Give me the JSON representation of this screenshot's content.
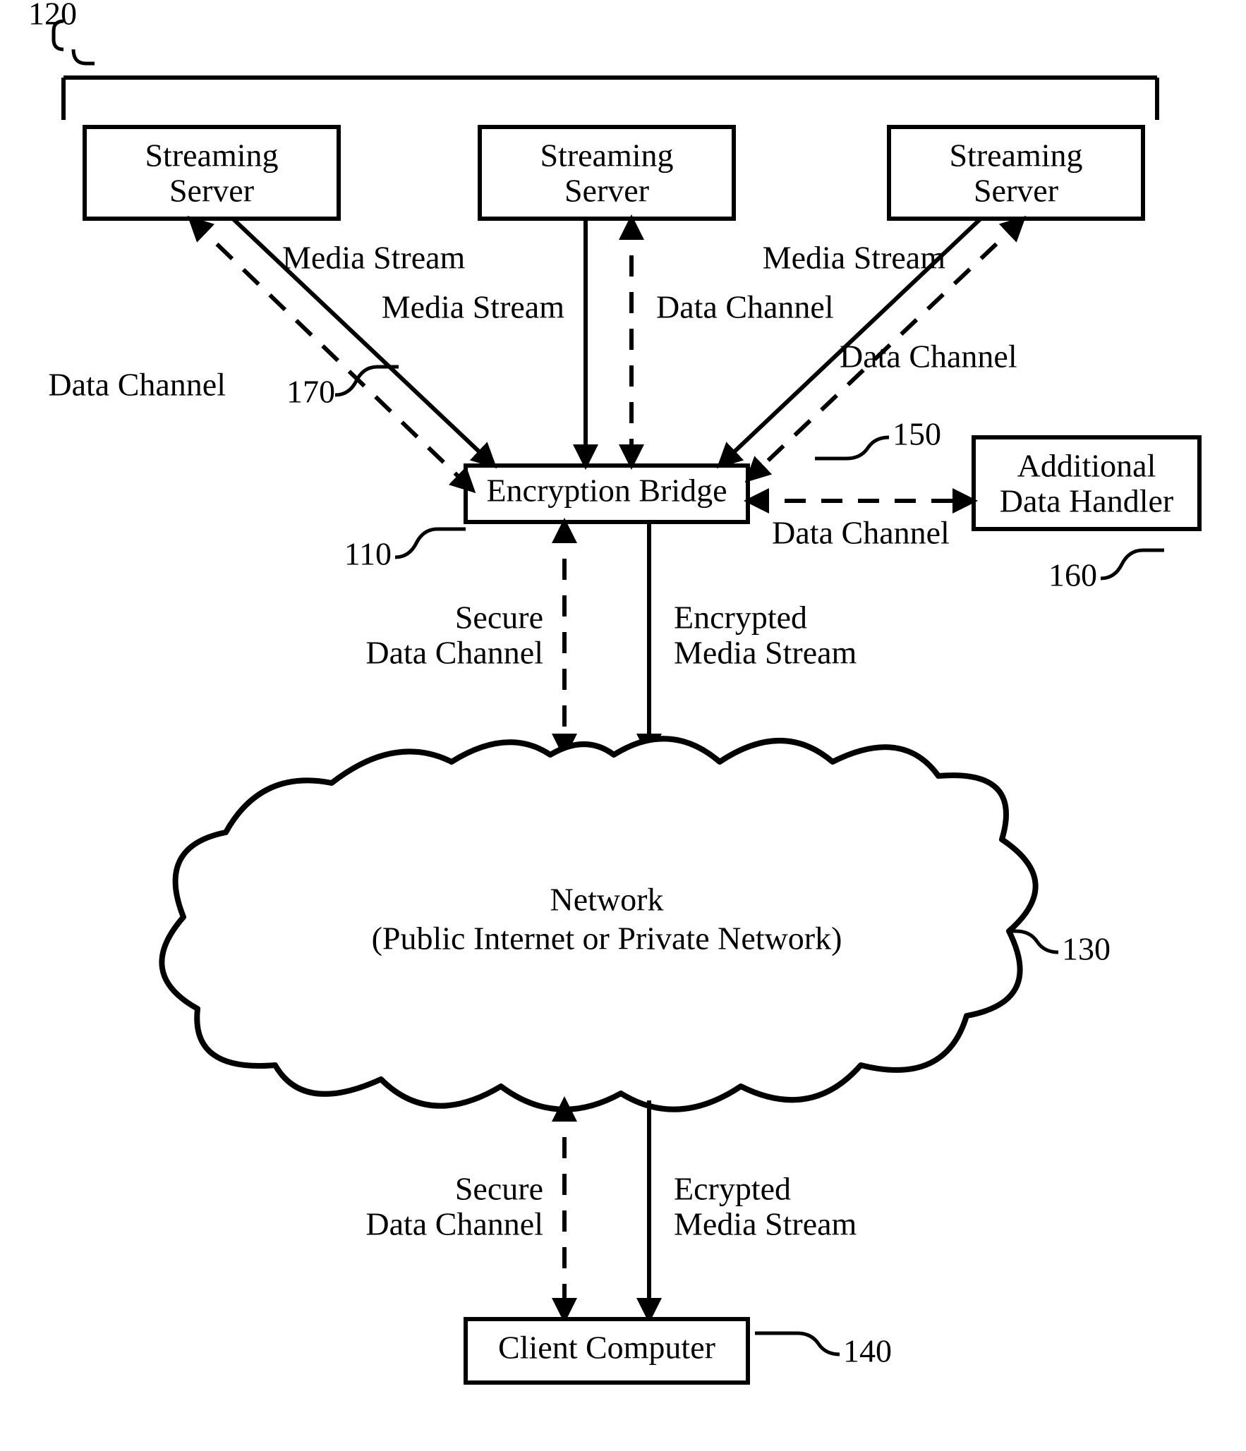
{
  "refs": {
    "group": "120",
    "bridge": "110",
    "network": "130",
    "client": "140",
    "handlerLink": "150",
    "handler": "160",
    "mediaLabel": "170"
  },
  "nodes": {
    "server1": {
      "line1": "Streaming",
      "line2": "Server"
    },
    "server2": {
      "line1": "Streaming",
      "line2": "Server"
    },
    "server3": {
      "line1": "Streaming",
      "line2": "Server"
    },
    "bridge": "Encryption Bridge",
    "handler": {
      "line1": "Additional",
      "line2": "Data Handler"
    },
    "network": {
      "line1": "Network",
      "line2": "(Public Internet or Private Network)"
    },
    "client": "Client Computer"
  },
  "edges": {
    "mediaStream": "Media Stream",
    "dataChannel": "Data Channel",
    "secureDataChannel": {
      "line1": "Secure",
      "line2": "Data Channel"
    },
    "encryptedMediaStream": {
      "line1": "Encrypted",
      "line2": "Media Stream"
    },
    "ecryptedMediaStream": {
      "line1": "Ecrypted",
      "line2": "Media Stream"
    }
  }
}
